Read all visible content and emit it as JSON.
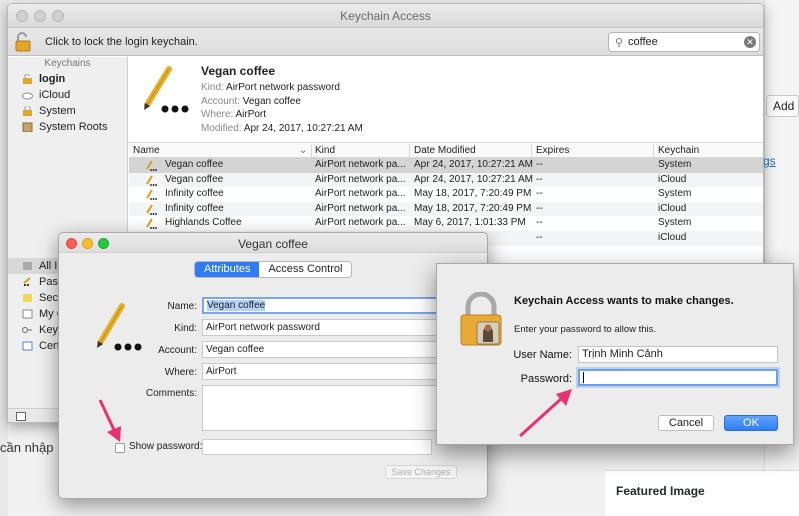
{
  "background": {
    "add_button": "Add",
    "link_text": "gs",
    "featured_title": "Featured Image",
    "left_text": "cần nhập"
  },
  "keychain_window": {
    "title": "Keychain Access",
    "lock_text": "Click to lock the login keychain.",
    "search_value": "coffee",
    "sidebar": {
      "header": "Keychains",
      "items": [
        {
          "label": "login",
          "icon": "lock-open-icon",
          "selected": true
        },
        {
          "label": "iCloud",
          "icon": "cloud-icon",
          "selected": false
        },
        {
          "label": "System",
          "icon": "lock-icon",
          "selected": false
        },
        {
          "label": "System Roots",
          "icon": "cabinet-icon",
          "selected": false
        }
      ],
      "category_header": "Ca",
      "categories": [
        {
          "label": "All I",
          "icon": "all-items-icon"
        },
        {
          "label": "Pass",
          "icon": "password-icon"
        },
        {
          "label": "Sec",
          "icon": "secure-note-icon"
        },
        {
          "label": "My C",
          "icon": "certificate-icon"
        },
        {
          "label": "Keys",
          "icon": "key-icon"
        },
        {
          "label": "Cert",
          "icon": "certificate-icon"
        }
      ]
    },
    "detail": {
      "name": "Vegan coffee",
      "kind_label": "Kind:",
      "kind": "AirPort network password",
      "account_label": "Account:",
      "account": "Vegan coffee",
      "where_label": "Where:",
      "where": "AirPort",
      "modified_label": "Modified:",
      "modified": "Apr 24, 2017, 10:27:21 AM"
    },
    "table": {
      "columns": [
        "Name",
        "Kind",
        "Date Modified",
        "Expires",
        "Keychain"
      ],
      "rows": [
        {
          "name": "Vegan coffee",
          "kind": "AirPort network pa...",
          "date": "Apr 24, 2017, 10:27:21 AM",
          "expires": "--",
          "keychain": "System"
        },
        {
          "name": "Vegan coffee",
          "kind": "AirPort network pa...",
          "date": "Apr 24, 2017, 10:27:21 AM",
          "expires": "--",
          "keychain": "iCloud"
        },
        {
          "name": "Infinity coffee",
          "kind": "AirPort network pa...",
          "date": "May 18, 2017, 7:20:49 PM",
          "expires": "--",
          "keychain": "System"
        },
        {
          "name": "Infinity coffee",
          "kind": "AirPort network pa...",
          "date": "May 18, 2017, 7:20:49 PM",
          "expires": "--",
          "keychain": "iCloud"
        },
        {
          "name": "Highlands Coffee",
          "kind": "AirPort network pa...",
          "date": "May 6, 2017, 1:01:33 PM",
          "expires": "--",
          "keychain": "System"
        },
        {
          "name": "",
          "kind": "",
          "date": "33 PM",
          "expires": "--",
          "keychain": "iCloud"
        }
      ]
    }
  },
  "item_dialog": {
    "title": "Vegan coffee",
    "tabs": [
      "Attributes",
      "Access Control"
    ],
    "name_label": "Name:",
    "name_value": "Vegan coffee",
    "kind_label": "Kind:",
    "kind_value": "AirPort network password",
    "account_label": "Account:",
    "account_value": "Vegan coffee",
    "where_label": "Where:",
    "where_value": "AirPort",
    "comments_label": "Comments:",
    "show_password_label": "Show password:",
    "save_button": "Save Changes"
  },
  "auth_dialog": {
    "title": "Keychain Access wants to make changes.",
    "subtitle": "Enter your password to allow this.",
    "username_label": "User Name:",
    "username_value": "Trịnh Minh Cảnh",
    "password_label": "Password:",
    "password_value": "",
    "cancel_button": "Cancel",
    "ok_button": "OK"
  },
  "colors": {
    "accent": "#2f7bf5",
    "annotation_arrow": "#e8326b",
    "selection_row": "#d4d4d4"
  }
}
